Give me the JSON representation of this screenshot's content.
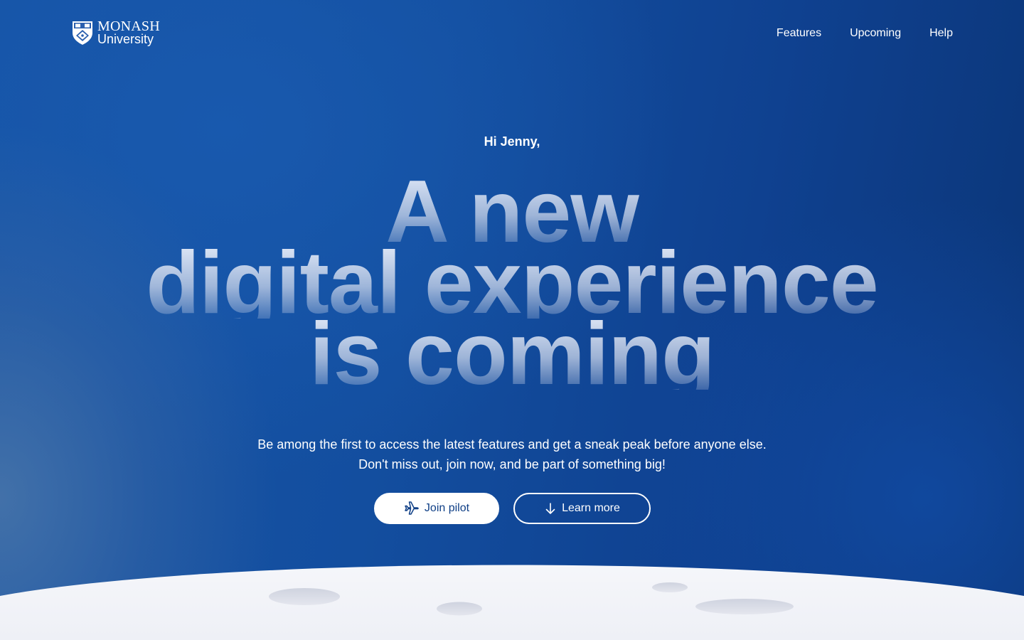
{
  "brand": {
    "name_top": "MONASH",
    "name_bottom": "University",
    "crest_icon": "monash-crest-icon"
  },
  "nav": {
    "items": [
      {
        "label": "Features"
      },
      {
        "label": "Upcoming"
      },
      {
        "label": "Help"
      }
    ]
  },
  "hero": {
    "greeting": "Hi Jenny,",
    "headline_lines": [
      "A new",
      "digital experience",
      "is coming"
    ],
    "subtitle_line1": "Be among the first to access the latest features and get a sneak peak before anyone else.",
    "subtitle_line2": "Don't miss out, join now, and be part of something big!",
    "primary_button": {
      "label": "Join pilot",
      "icon": "airplane-icon"
    },
    "secondary_button": {
      "label": "Learn more",
      "icon": "arrow-down-icon"
    }
  },
  "colors": {
    "background_primary": "#134e9f",
    "background_dark": "#0b3577",
    "button_text": "#0f3f86",
    "moon": "#f2f3f8",
    "crater": "#dde0ea"
  }
}
